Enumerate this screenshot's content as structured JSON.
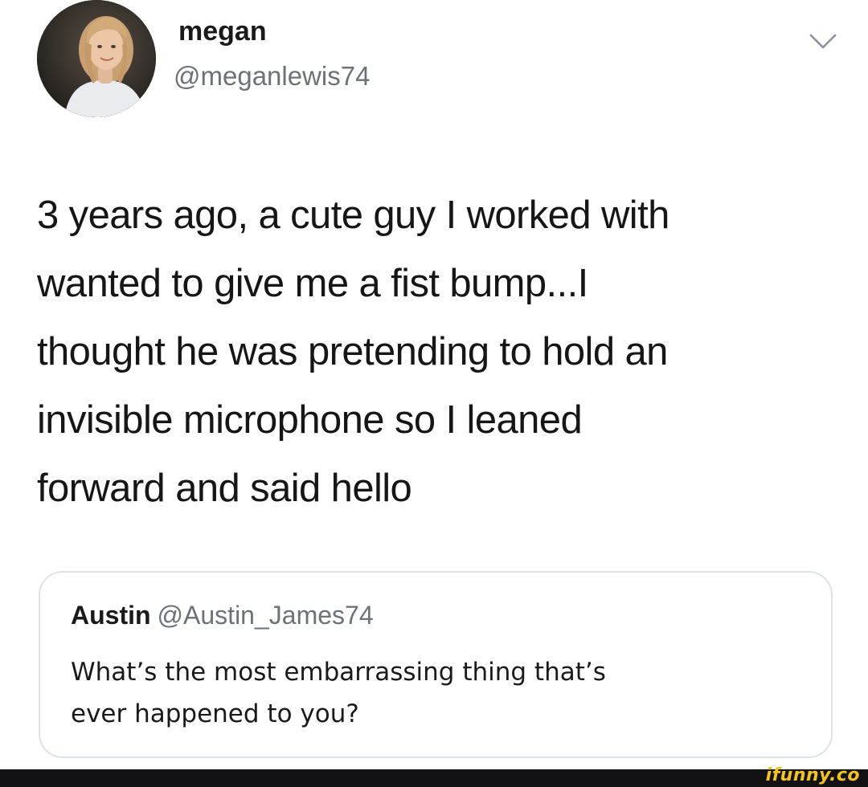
{
  "author": {
    "display_name": "megan",
    "handle": "@meganlewis74",
    "avatar_icon": "profile-photo",
    "menu_icon": "chevron-down-icon"
  },
  "tweet": {
    "lines": [
      "3 years ago, a cute guy I worked with",
      "wanted to give me a fist bump...I",
      "thought he was pretending to hold an",
      "invisible microphone so I leaned",
      "forward and said hello"
    ]
  },
  "quoted_tweet": {
    "display_name": "Austin",
    "handle": "@Austin_James74",
    "lines": [
      "What’s the most embarrassing thing that’s",
      "ever happened to you?"
    ]
  },
  "watermark": {
    "text": "ifunny.co",
    "color": "#f5c418"
  },
  "colors": {
    "text": "#1a1a1a",
    "secondary_text": "#6c7278",
    "card_border": "#dfe3e7",
    "footer_bg": "#121214"
  }
}
